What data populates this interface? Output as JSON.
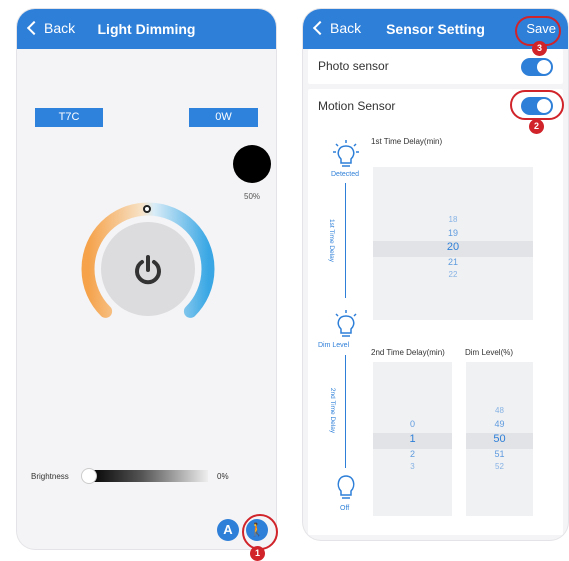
{
  "left": {
    "nav": {
      "back": "Back",
      "title": "Light Dimming"
    },
    "cct_label": "T7C",
    "power_label": "0W",
    "level_percent": "50%",
    "brightness": {
      "label": "Brightness",
      "value": "0%"
    },
    "markers": {
      "motion": "1"
    },
    "mode_icon_letter": "A"
  },
  "right": {
    "nav": {
      "back": "Back",
      "title": "Sensor Setting",
      "save": "Save"
    },
    "photo_sensor": {
      "label": "Photo sensor",
      "on": true
    },
    "motion_sensor": {
      "label": "Motion Sensor",
      "on": true
    },
    "markers": {
      "save": "3",
      "motion_toggle": "2"
    },
    "timeline": {
      "detected": "Detected",
      "dim_level": "Dim Level",
      "off": "Off",
      "first_delay_vertical": "1st Time Delay",
      "second_delay_vertical": "2nd Time Delay"
    },
    "first_delay": {
      "label": "1st Time Delay(min)",
      "values": [
        "18",
        "19",
        "20",
        "21",
        "22"
      ],
      "selected": "20"
    },
    "second_delay": {
      "label": "2nd Time Delay(min)",
      "values": [
        "0",
        "1",
        "2",
        "3"
      ],
      "selected": "1"
    },
    "dim_level": {
      "label": "Dim Level(%)",
      "values": [
        "48",
        "49",
        "50",
        "51",
        "52"
      ],
      "selected": "50"
    }
  },
  "colors": {
    "accent": "#2e7fd8",
    "marker": "#d0232a",
    "warm": "#f5a24a",
    "cool": "#3aa7e4"
  }
}
